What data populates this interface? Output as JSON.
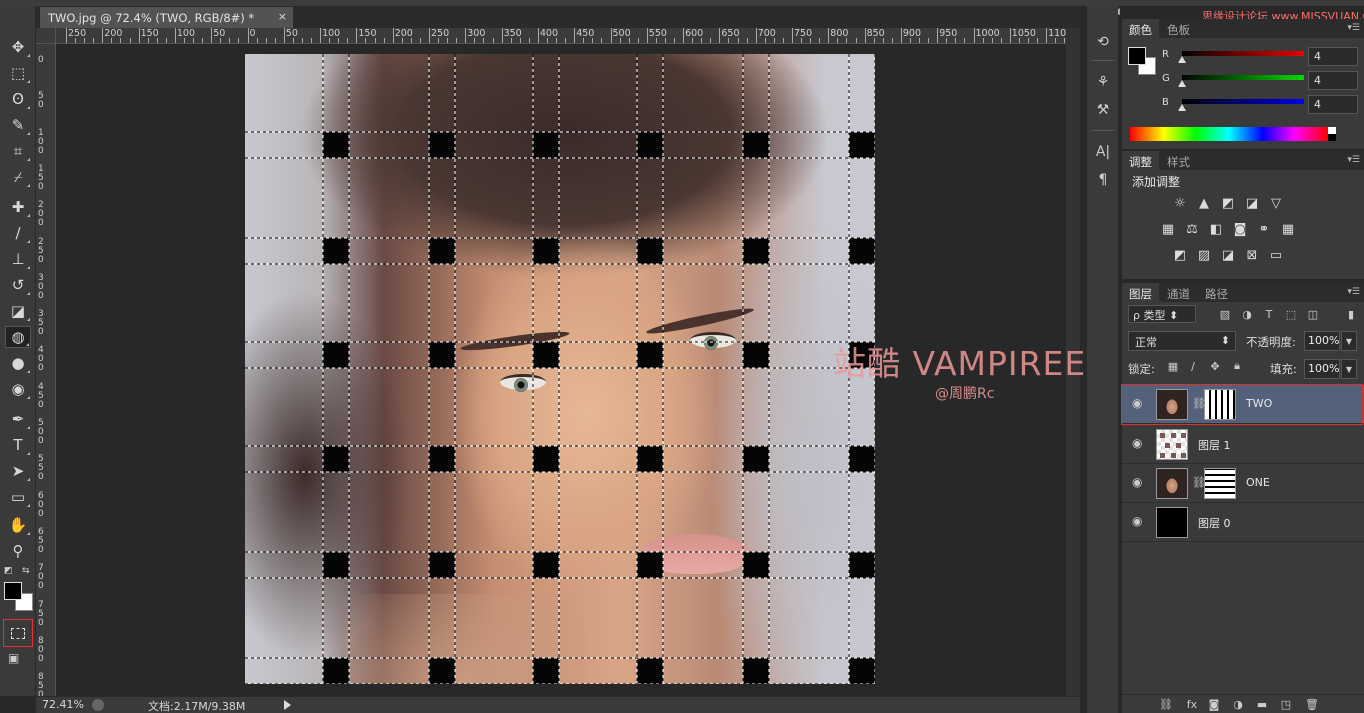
{
  "document": {
    "tab_title": "TWO.jpg @ 72.4% (TWO, RGB/8#) *",
    "close_glyph": "×"
  },
  "ruler": {
    "top_labels": [
      "250",
      "200",
      "150",
      "100",
      "50",
      "0",
      "50",
      "100",
      "150",
      "200",
      "250",
      "300",
      "350",
      "400",
      "450",
      "500",
      "550",
      "600",
      "650",
      "700",
      "750",
      "800",
      "850",
      "900",
      "950",
      "1000",
      "1050",
      "1100"
    ],
    "left_labels": [
      "0",
      "50",
      "100",
      "150",
      "200",
      "250",
      "300",
      "350",
      "400",
      "450",
      "500",
      "550",
      "600",
      "650",
      "700",
      "750",
      "800",
      "850"
    ]
  },
  "watermark": {
    "main": "站酷 VAMPIREE",
    "sub": "@周鹏Rc"
  },
  "site_tag": "思缘设计论坛 www.MISSVUAN.COM",
  "status": {
    "zoom": "72.41%",
    "doc": "文档:2.17M/9.38M"
  },
  "color_panel": {
    "tabs": [
      "颜色",
      "色板"
    ],
    "channels": [
      {
        "label": "R",
        "value": "4"
      },
      {
        "label": "G",
        "value": "4"
      },
      {
        "label": "B",
        "value": "4"
      }
    ]
  },
  "adjust_panel": {
    "tabs": [
      "调整",
      "样式"
    ],
    "heading": "添加调整"
  },
  "layers_panel": {
    "tabs": [
      "图层",
      "通道",
      "路径"
    ],
    "kind": "ρ 类型",
    "blend_mode": "正常",
    "opacity_label": "不透明度:",
    "opacity": "100%",
    "lock_label": "锁定:",
    "fill_label": "填充:",
    "fill": "100%",
    "layers": [
      {
        "name": "TWO",
        "selected": true
      },
      {
        "name": "图层 1",
        "selected": false
      },
      {
        "name": "ONE",
        "selected": false
      },
      {
        "name": "图层 0",
        "selected": false
      }
    ]
  },
  "colors": {
    "selection_outline": "#e03030",
    "selected_layer": "#53617a",
    "watermark": "#eb9696"
  }
}
